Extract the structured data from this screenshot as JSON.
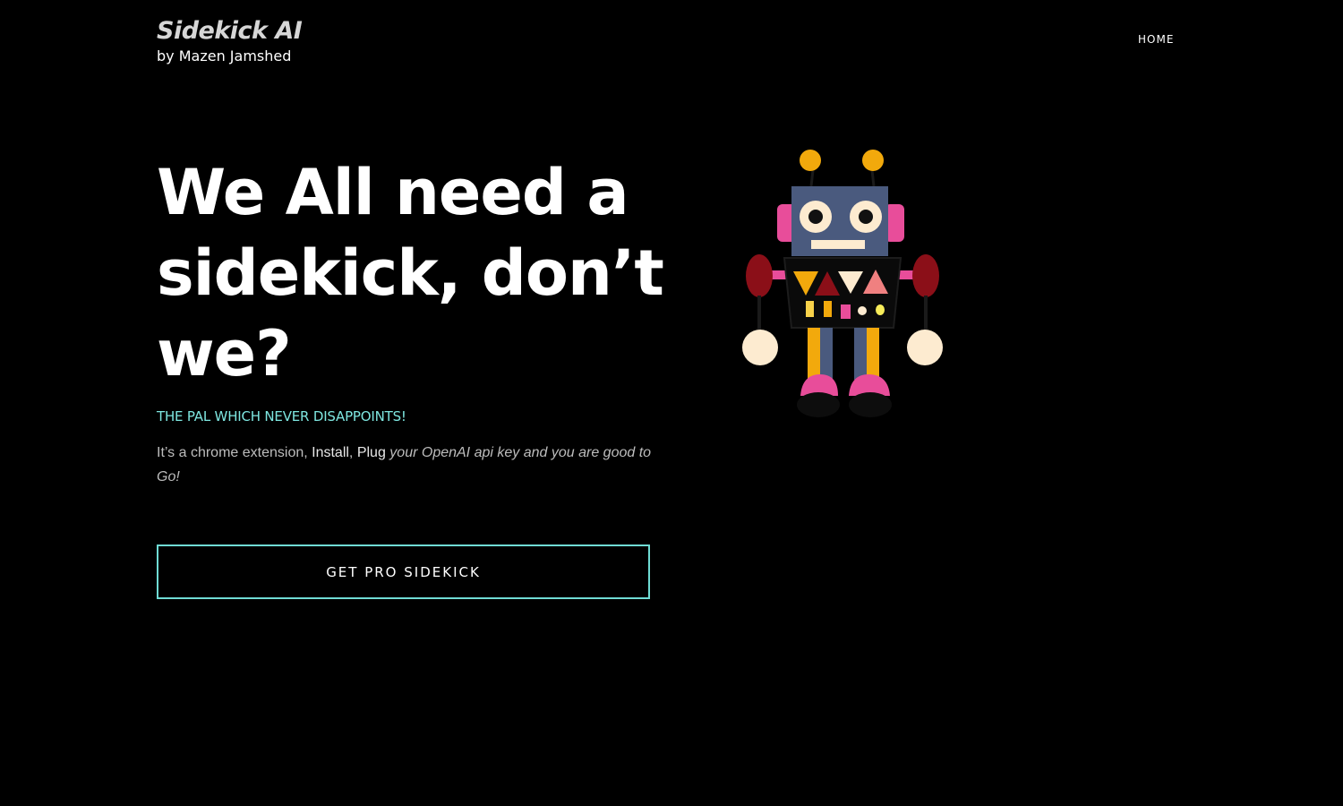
{
  "header": {
    "brand_title": "Sidekick AI",
    "brand_subtitle": "by Mazen Jamshed",
    "nav": [
      {
        "label": "HOME"
      }
    ]
  },
  "hero": {
    "heading_lines": [
      "We All need a",
      "sidekick, don’t",
      "we?"
    ],
    "tagline": "THE PAL WHICH NEVER DISAPPOINTS!",
    "description": {
      "part1": "It’s a chrome extension, ",
      "install": "Install",
      "comma": ", ",
      "plug": "Plug",
      "space": " ",
      "italic": "your OpenAI api key and you are good to Go!"
    },
    "cta_label": "GET PRO SIDEKICK"
  },
  "colors": {
    "background": "#000000",
    "accent_teal": "#6fdbd4",
    "brand_gray": "#d6d6d6"
  },
  "illustration": {
    "name": "robot-illustration"
  }
}
